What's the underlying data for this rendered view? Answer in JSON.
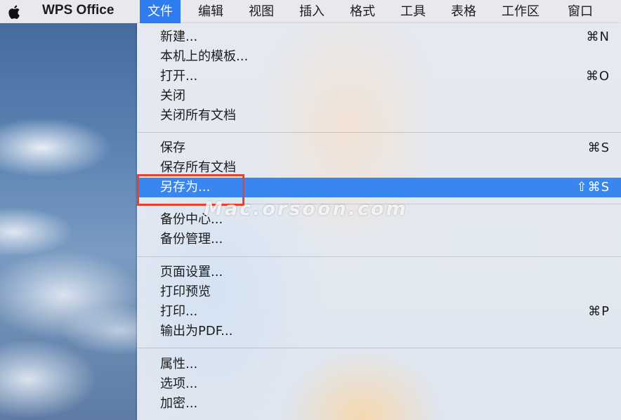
{
  "menubar": {
    "apple_icon": "apple-icon",
    "app_name": "WPS Office",
    "items": [
      "文件",
      "编辑",
      "视图",
      "插入",
      "格式",
      "工具",
      "表格",
      "工作区",
      "窗口"
    ],
    "active_item": "文件"
  },
  "file_menu": {
    "groups": [
      [
        {
          "label": "新建...",
          "shortcut": "⌘N"
        },
        {
          "label": "本机上的模板...",
          "shortcut": ""
        },
        {
          "label": "打开...",
          "shortcut": "⌘O"
        },
        {
          "label": "关闭",
          "shortcut": ""
        },
        {
          "label": "关闭所有文档",
          "shortcut": ""
        }
      ],
      [
        {
          "label": "保存",
          "shortcut": "⌘S"
        },
        {
          "label": "保存所有文档",
          "shortcut": ""
        },
        {
          "label": "另存为...",
          "shortcut": "⇧⌘S",
          "highlighted": true
        }
      ],
      [
        {
          "label": "备份中心...",
          "shortcut": ""
        },
        {
          "label": "备份管理...",
          "shortcut": ""
        }
      ],
      [
        {
          "label": "页面设置...",
          "shortcut": ""
        },
        {
          "label": "打印预览",
          "shortcut": ""
        },
        {
          "label": "打印...",
          "shortcut": "⌘P"
        },
        {
          "label": "输出为PDF...",
          "shortcut": ""
        }
      ],
      [
        {
          "label": "属性...",
          "shortcut": ""
        },
        {
          "label": "选项...",
          "shortcut": ""
        },
        {
          "label": "加密...",
          "shortcut": ""
        }
      ]
    ]
  },
  "watermark": "Mac.orsoon.com",
  "colors": {
    "highlight": "#3a86f0",
    "menubar_active": "#2f7bf0",
    "annotation_box": "#e8422f"
  }
}
